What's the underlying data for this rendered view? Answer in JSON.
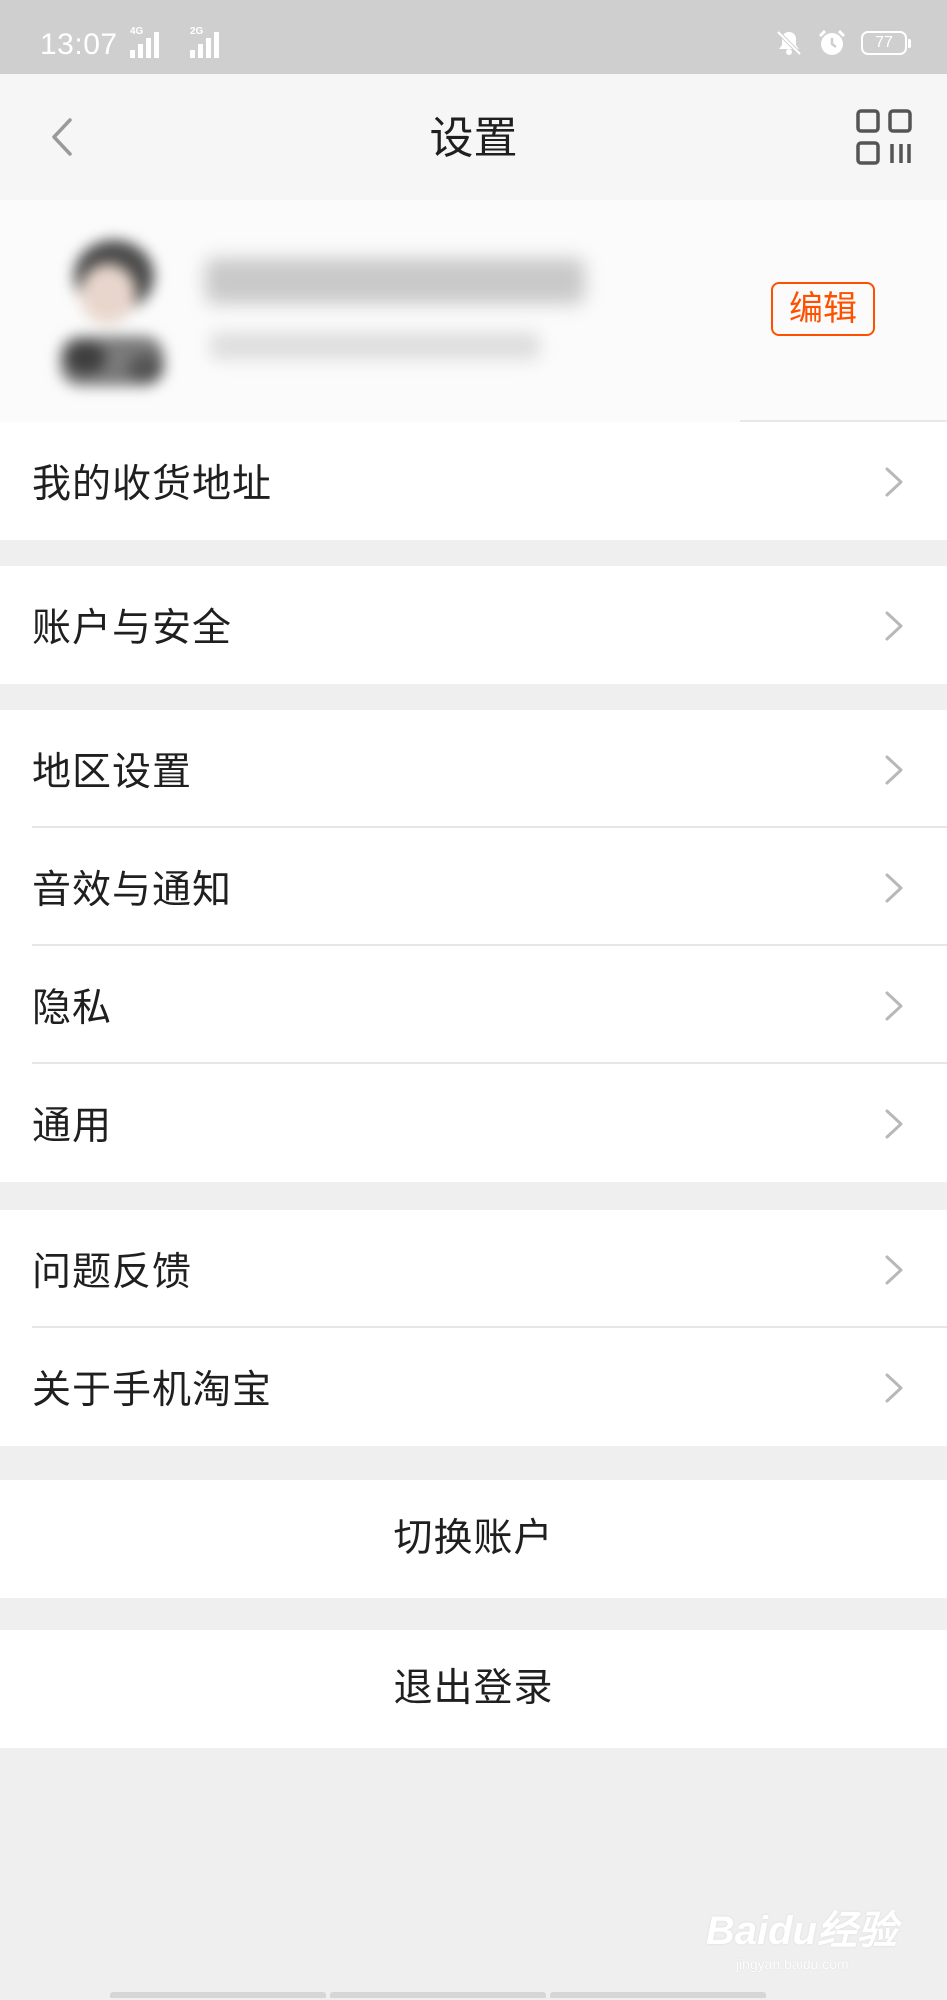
{
  "status_bar": {
    "time": "13:07",
    "signal_1_label": "4G",
    "signal_2_label": "2G",
    "battery": "77",
    "icons": [
      "bell-muted-icon",
      "alarm-icon",
      "battery-icon"
    ]
  },
  "nav": {
    "title": "设置",
    "back_icon": "chevron-left-icon",
    "qr_icon": "qr-code-icon"
  },
  "profile": {
    "edit_label": "编辑"
  },
  "groups": [
    {
      "items": [
        {
          "label": "我的收货地址"
        }
      ]
    },
    {
      "items": [
        {
          "label": "账户与安全"
        }
      ]
    },
    {
      "items": [
        {
          "label": "地区设置"
        },
        {
          "label": "音效与通知"
        },
        {
          "label": "隐私"
        },
        {
          "label": "通用"
        }
      ]
    },
    {
      "items": [
        {
          "label": "问题反馈"
        },
        {
          "label": "关于手机淘宝"
        }
      ]
    }
  ],
  "actions": {
    "switch_account": "切换账户",
    "logout": "退出登录"
  },
  "watermark": {
    "main": "Baidu经验",
    "sub": "jingyan.baidu.com"
  },
  "colors": {
    "accent": "#ff5000",
    "page_bg": "#efefef",
    "status_bar_bg": "#cfcfcf"
  }
}
